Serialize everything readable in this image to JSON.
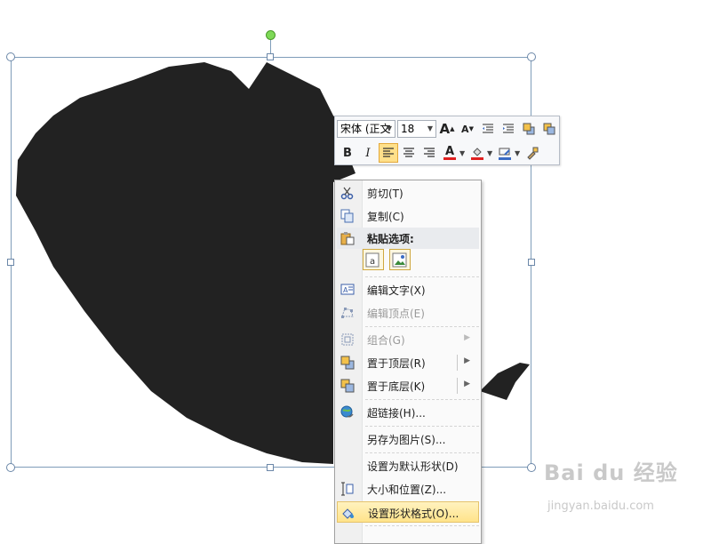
{
  "mini_toolbar": {
    "font_name": "宋体 (正文",
    "font_size": "18",
    "icons": [
      "grow-font-icon",
      "shrink-font-icon",
      "decrease-indent-icon",
      "increase-indent-icon",
      "bring-forward-icon",
      "send-backward-icon"
    ],
    "bold": "B",
    "italic": "I",
    "grow_glyph": "A",
    "shrink_glyph": "A",
    "font_color": "A",
    "accent": "#e3a83b"
  },
  "context_menu": {
    "items": [
      {
        "label": "剪切(T)",
        "icon": "scissors-icon"
      },
      {
        "label": "复制(C)",
        "icon": "copy-icon"
      },
      {
        "label": "粘贴选项:",
        "icon": "paste-icon"
      },
      {
        "label": "编辑文字(X)",
        "icon": "edit-text-icon"
      },
      {
        "label": "编辑顶点(E)",
        "icon": "edit-points-icon"
      },
      {
        "label": "组合(G)",
        "icon": "group-icon"
      },
      {
        "label": "置于顶层(R)",
        "icon": "bring-to-front-icon"
      },
      {
        "label": "置于底层(K)",
        "icon": "send-to-back-icon"
      },
      {
        "label": "超链接(H)...",
        "icon": "hyperlink-icon"
      },
      {
        "label": "另存为图片(S)...",
        "icon": ""
      },
      {
        "label": "设置为默认形状(D)",
        "icon": ""
      },
      {
        "label": "大小和位置(Z)...",
        "icon": "size-position-icon"
      },
      {
        "label": "设置形状格式(O)...",
        "icon": "format-shape-icon"
      }
    ],
    "highlight_color": "#ffe38a"
  },
  "shape": {
    "fill_color": "#222222"
  },
  "watermark": {
    "brand": "Bai du 经验",
    "site": "jingyan.baidu.com"
  }
}
